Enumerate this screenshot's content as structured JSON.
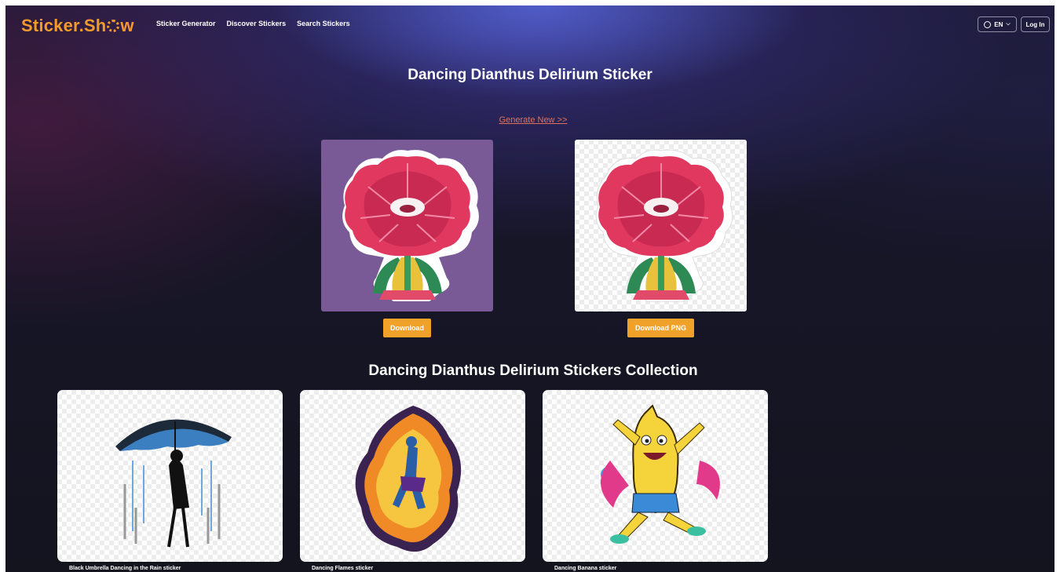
{
  "brand": {
    "logo": "Sticker.Show"
  },
  "nav": {
    "items": [
      "Sticker Generator",
      "Discover Stickers",
      "Search Stickers"
    ]
  },
  "header_actions": {
    "language": "EN",
    "login": "Log In"
  },
  "page": {
    "title": "Dancing Dianthus Delirium Sticker",
    "generate_link": "Generate New >>",
    "download_label": "Download",
    "download_png_label": "Download PNG"
  },
  "collection": {
    "title": "Dancing Dianthus Delirium Stickers Collection",
    "items": [
      {
        "label": "Black Umbrella Dancing in the Rain sticker"
      },
      {
        "label": "Dancing Flames sticker"
      },
      {
        "label": "Dancing Banana sticker"
      }
    ]
  },
  "colors": {
    "accent": "#f0a12a",
    "link": "#e3705a",
    "logo": "#f39a2d"
  }
}
